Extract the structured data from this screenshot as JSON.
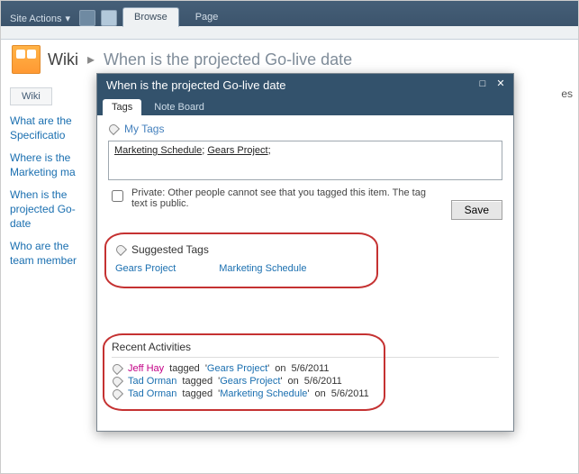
{
  "ribbon": {
    "site_actions": "Site Actions",
    "browse": "Browse",
    "page": "Page"
  },
  "breadcrumb": {
    "library": "Wiki",
    "sep": "▸",
    "title": "When is the projected Go-live date"
  },
  "left_nav": {
    "tab": "Wiki",
    "items": [
      "What are the Specificatio",
      "Where is the Marketing ma",
      "When is the projected Go-date",
      "Who are the team member"
    ]
  },
  "cut_text": "es",
  "dialog": {
    "title": "When is the projected Go-live date",
    "tabs": {
      "tags": "Tags",
      "noteboard": "Note Board"
    },
    "my_tags": "My Tags",
    "tag_values": [
      "Marketing Schedule",
      "Gears Project"
    ],
    "tag_sep": "; ",
    "tag_trail": ";",
    "private_label": "Private: Other people cannot see that you tagged this item. The tag text is public.",
    "save": "Save",
    "suggested_label": "Suggested Tags",
    "suggested": [
      "Gears Project",
      "Marketing Schedule"
    ],
    "recent_label": "Recent Activities",
    "activities": [
      {
        "user": "Jeff Hay",
        "style": "1",
        "verb": "tagged",
        "tag": "Gears Project",
        "on": "on",
        "date": "5/6/2011"
      },
      {
        "user": "Tad Orman",
        "style": "2",
        "verb": "tagged",
        "tag": "Gears Project",
        "on": "on",
        "date": "5/6/2011"
      },
      {
        "user": "Tad Orman",
        "style": "2",
        "verb": "tagged",
        "tag": "Marketing Schedule",
        "on": "on",
        "date": "5/6/2011"
      }
    ]
  }
}
